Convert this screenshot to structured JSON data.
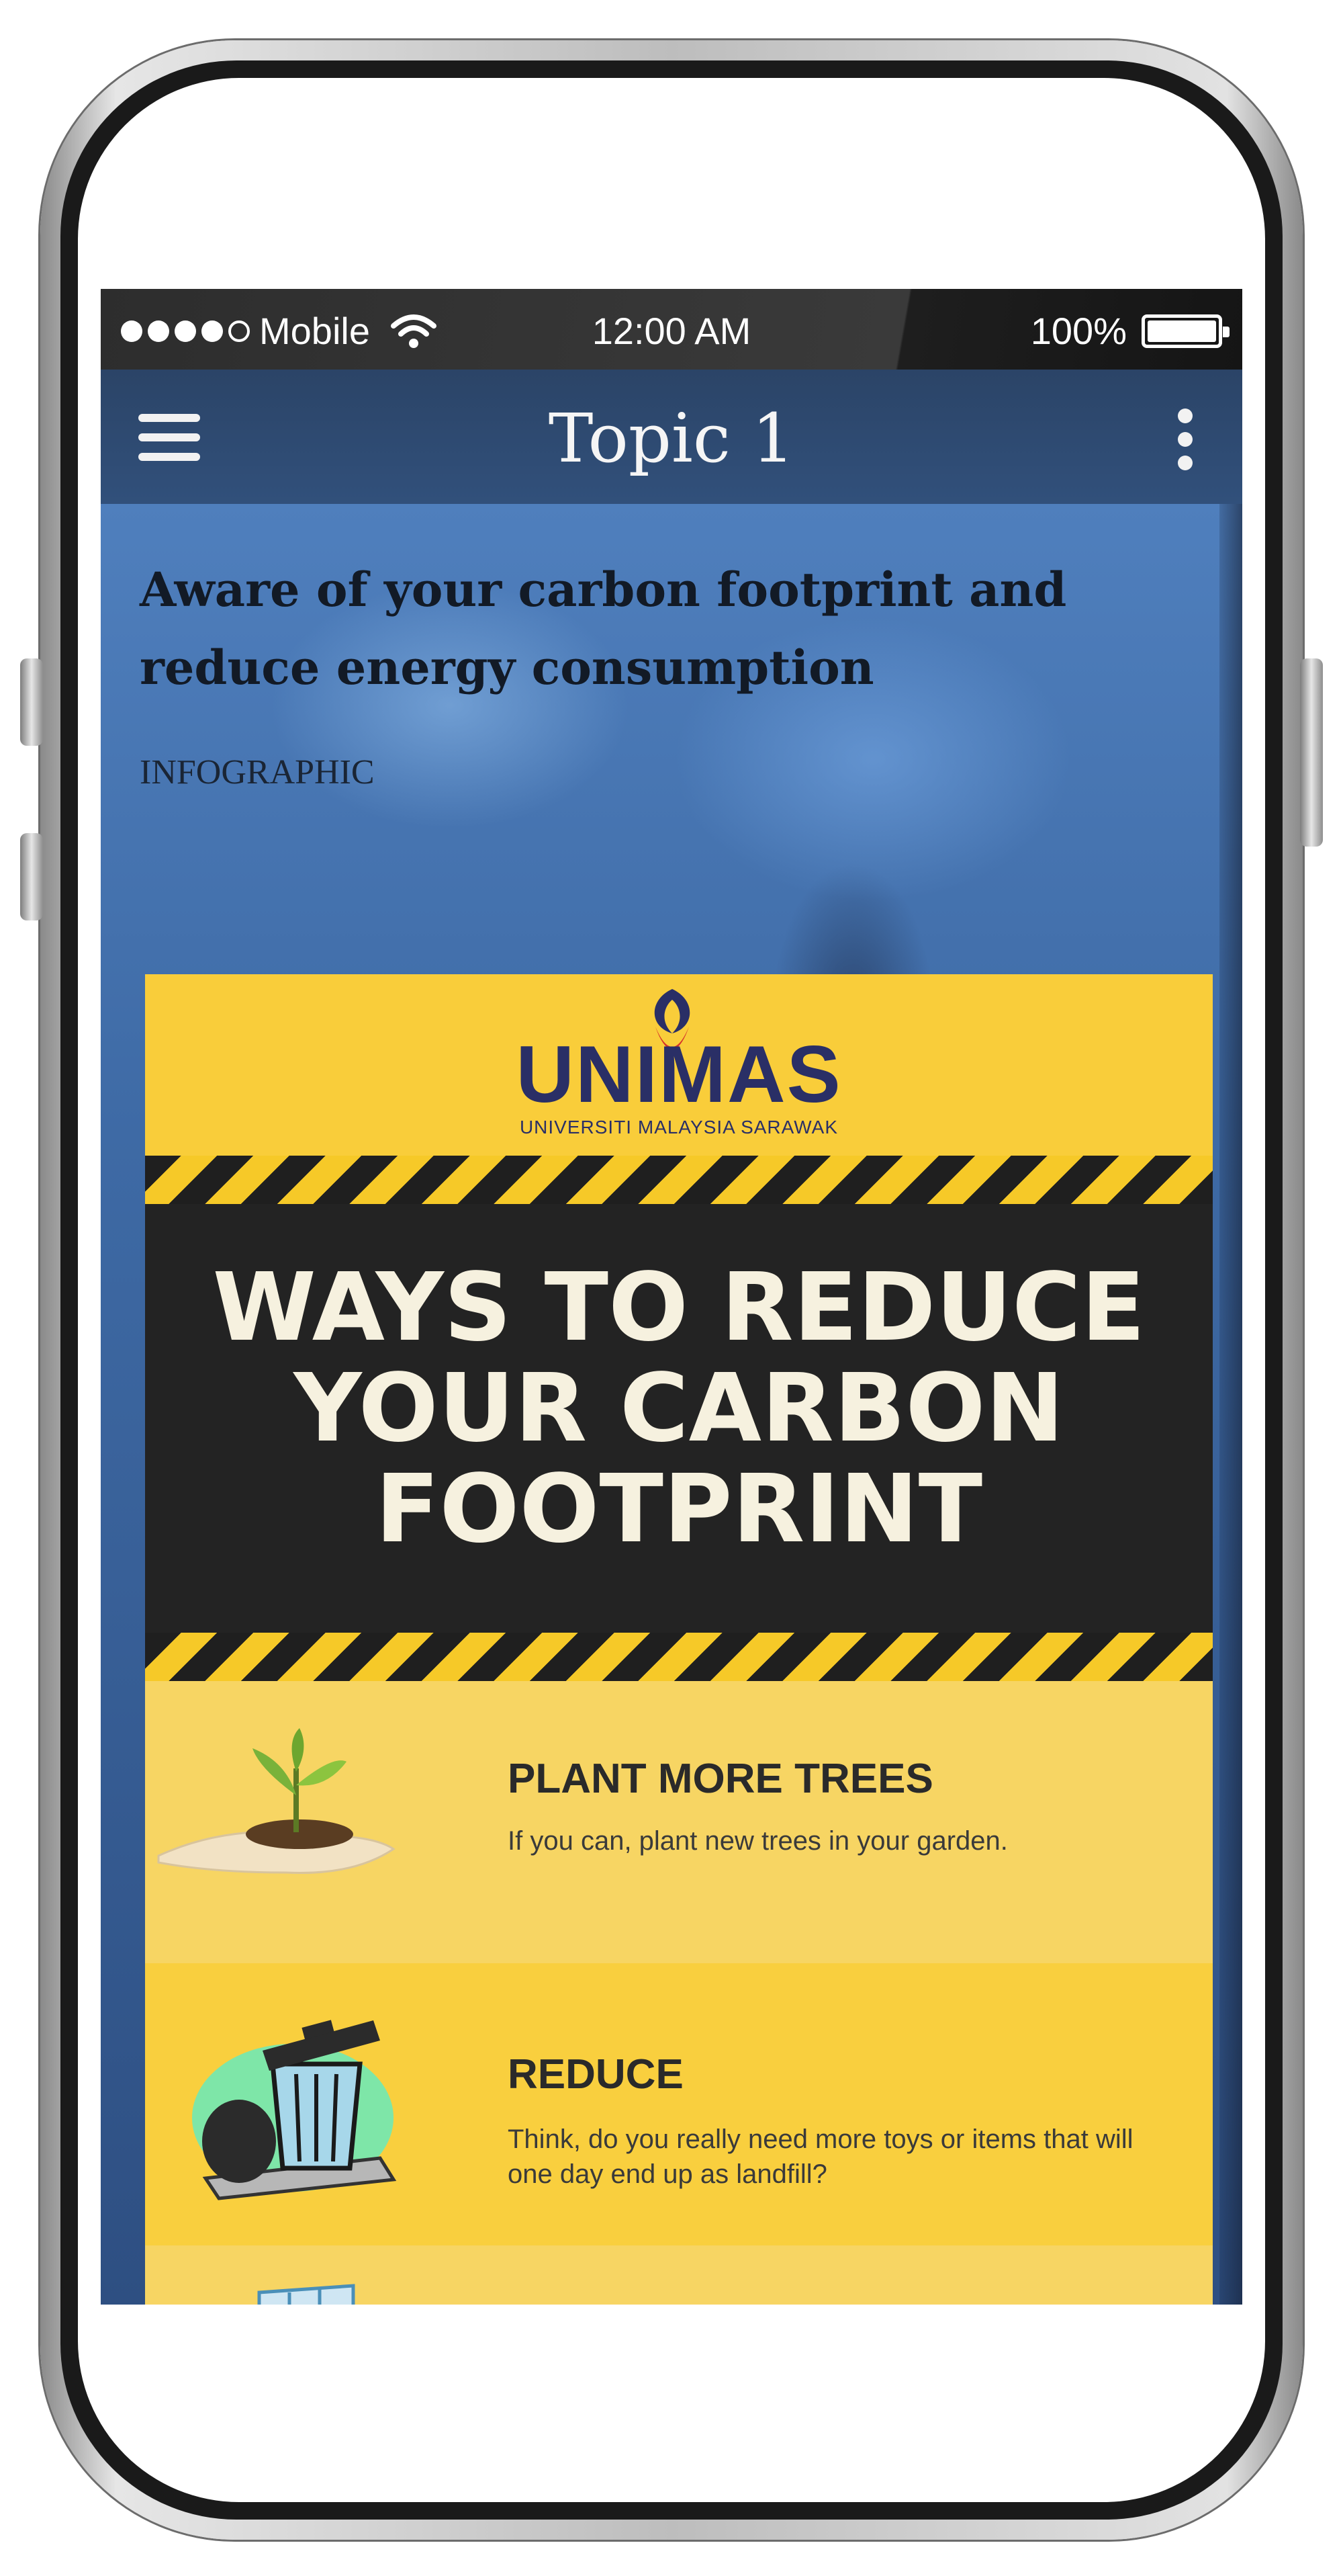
{
  "status_bar": {
    "carrier": "Mobile",
    "time": "12:00 AM",
    "battery": "100%",
    "signal_icon": "signal-dots-icon",
    "wifi_icon": "wifi-icon",
    "battery_icon": "battery-icon"
  },
  "app_bar": {
    "title": "Topic 1",
    "menu_icon": "hamburger-menu-icon",
    "more_icon": "more-vert-icon"
  },
  "article": {
    "headline": "Aware of your carbon footprint and reduce energy consumption",
    "tag": "INFOGRAPHIC"
  },
  "infographic": {
    "logo_text": "UNIMAS",
    "logo_subtitle": "UNIVERSITI MALAYSIA SARAWAK",
    "title": "WAYS TO REDUCE YOUR CARBON FOOTPRINT",
    "title_lines": [
      "WAYS TO REDUCE",
      "YOUR CARBON",
      "FOOTPRINT"
    ],
    "tips": [
      {
        "title": "PLANT MORE TREES",
        "text": "If you can, plant new trees in your garden.",
        "icon": "seedling-in-hand-icon"
      },
      {
        "title": "REDUCE",
        "text": "Think, do you really need more toys or items that will one day end up as landfill?",
        "icon": "trash-can-icon"
      }
    ]
  },
  "colors": {
    "app_bar": "#2b4467",
    "infographic_yellow": "#f7d14c",
    "infographic_black": "#232323",
    "logo_navy": "#2a2f66"
  }
}
